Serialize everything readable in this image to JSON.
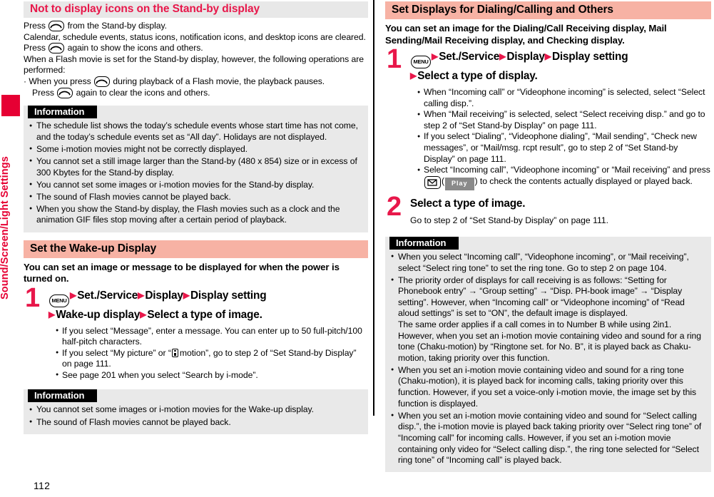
{
  "page": {
    "number": "112",
    "chapter_label": "Sound/Screen/Light Settings",
    "accent_red": "#e60033",
    "heading_pink": "#f7b2a4",
    "heading_gray": "#e8e8e8",
    "info_black": "#000000"
  },
  "left": {
    "section1": {
      "heading": "Not to display icons on the Stand-by display",
      "para1_a": "Press",
      "para1_b": "from the Stand-by display.",
      "para2": "Calendar, schedule events, status icons, notification icons, and desktop icons are cleared. Press",
      "para2_b": "again to show the icons and others.",
      "para3": "When a Flash movie is set for the Stand-by display, however, the following operations are performed:",
      "bullet1_a": "· When you press",
      "bullet1_b": "during playback of a Flash movie, the playback pauses.",
      "bullet2_a": "Press",
      "bullet2_b": "again to clear the icons and others.",
      "info": {
        "title": "Information",
        "items": [
          "The schedule list shows the today’s schedule events whose start time has not come, and the today’s schedule events set as “All day”. Holidays are not displayed.",
          "Some i-motion movies might not be correctly displayed.",
          "You cannot set a still image larger than the Stand-by (480 x 854) size or in excess of 300 Kbytes for the Stand-by display.",
          "You cannot set some images or i-motion movies for the Stand-by display.",
          "The sound of Flash movies cannot be played back.",
          "When you show the Stand-by display, the Flash movies such as a clock and the animation GIF files stop moving after a certain period of playback."
        ]
      }
    },
    "section2": {
      "heading": "Set the Wake-up Display",
      "intro": "You can set an image or message to be displayed for when the power is turned on.",
      "step1": {
        "num": "1",
        "key": "MENU",
        "line1_part1": "Set./Service",
        "line1_part2": "Display",
        "line1_part3": "Display setting",
        "line2_part1": "Wake-up display",
        "line2_part2": "Select a type of image.",
        "bullets": [
          "If you select “Message”, enter a message. You can enter up to 50 full-pitch/100 half-pitch characters.",
          "See page 201 when you select “Search by i-mode”."
        ],
        "bullet_motion_a": "If you select “My picture” or “",
        "bullet_motion_b": "motion”, go to step 2 of “Set Stand-by Display” on page 111."
      },
      "info": {
        "title": "Information",
        "items": [
          "You cannot set some images or i-motion movies for the Wake-up display.",
          "The sound of Flash movies cannot be played back."
        ]
      }
    }
  },
  "right": {
    "section1": {
      "heading": "Set Displays for Dialing/Calling and Others",
      "intro": "You can set an image for the Dialing/Call Receiving display, Mail Sending/Mail Receiving display, and Checking display.",
      "step1": {
        "num": "1",
        "key": "MENU",
        "line1_part1": "Set./Service",
        "line1_part2": "Display",
        "line1_part3": "Display setting",
        "line2_part1": "Select a type of display.",
        "bullets": [
          "When “Incoming call” or “Videophone incoming” is selected, select “Select calling disp.”.",
          "When “Mail receiving” is selected, select “Select receiving disp.” and go to step 2 of “Set Stand-by Display” on page 111.",
          "If you select “Dialing”, “Videophone dialing”, “Mail sending”, “Check new messages”, or “Mail/msg. rcpt result”, go to step 2 of “Set Stand-by Display” on page 111."
        ],
        "bullet_play_a": "Select “Incoming call”, “Videophone incoming” or “Mail receiving” and press",
        "bullet_play_key": "Play",
        "bullet_play_b": ") to check the contents actually displayed or played back."
      },
      "step2": {
        "num": "2",
        "head": "Select a type of image.",
        "sub": "Go to step 2 of “Set Stand-by Display” on page 111."
      },
      "info": {
        "title": "Information",
        "items": [
          "When you select “Incoming call”, “Videophone incoming”, or “Mail receiving”, select “Select ring tone” to set the ring tone. Go to step 2 on page 104.",
          "When you set an i-motion movie containing video and sound for a ring tone (Chaku-motion), it is played back for incoming calls, taking priority over this function. However, if you set a voice-only i-motion movie, the image set by this function is displayed.",
          "When you set an i-motion movie containing video and sound for “Select calling disp.”, the i-motion movie is played back taking priority over “Select ring tone” of “Incoming call” for incoming calls. However, if you set an i-motion movie containing only video for “Select calling disp.”, the ring tone selected for “Select ring tone” of “Incoming call” is played back."
        ],
        "priority_item_line1": "The priority order of displays for call receiving is as follows: “Setting for Phonebook entry” → “Group setting” → “Disp. PH-book image” → “Display setting”. However, when “Incoming call” or “Videophone incoming” of “Read aloud settings” is set to “ON”, the default image is displayed.",
        "priority_item_line2": "The same order applies if a call comes in to Number B while using 2in1. However, when you set an i-motion movie containing video and sound for a ring tone (Chaku-motion) by “Ringtone set. for No. B”, it is played back as Chaku-motion, taking priority over this function."
      }
    }
  }
}
